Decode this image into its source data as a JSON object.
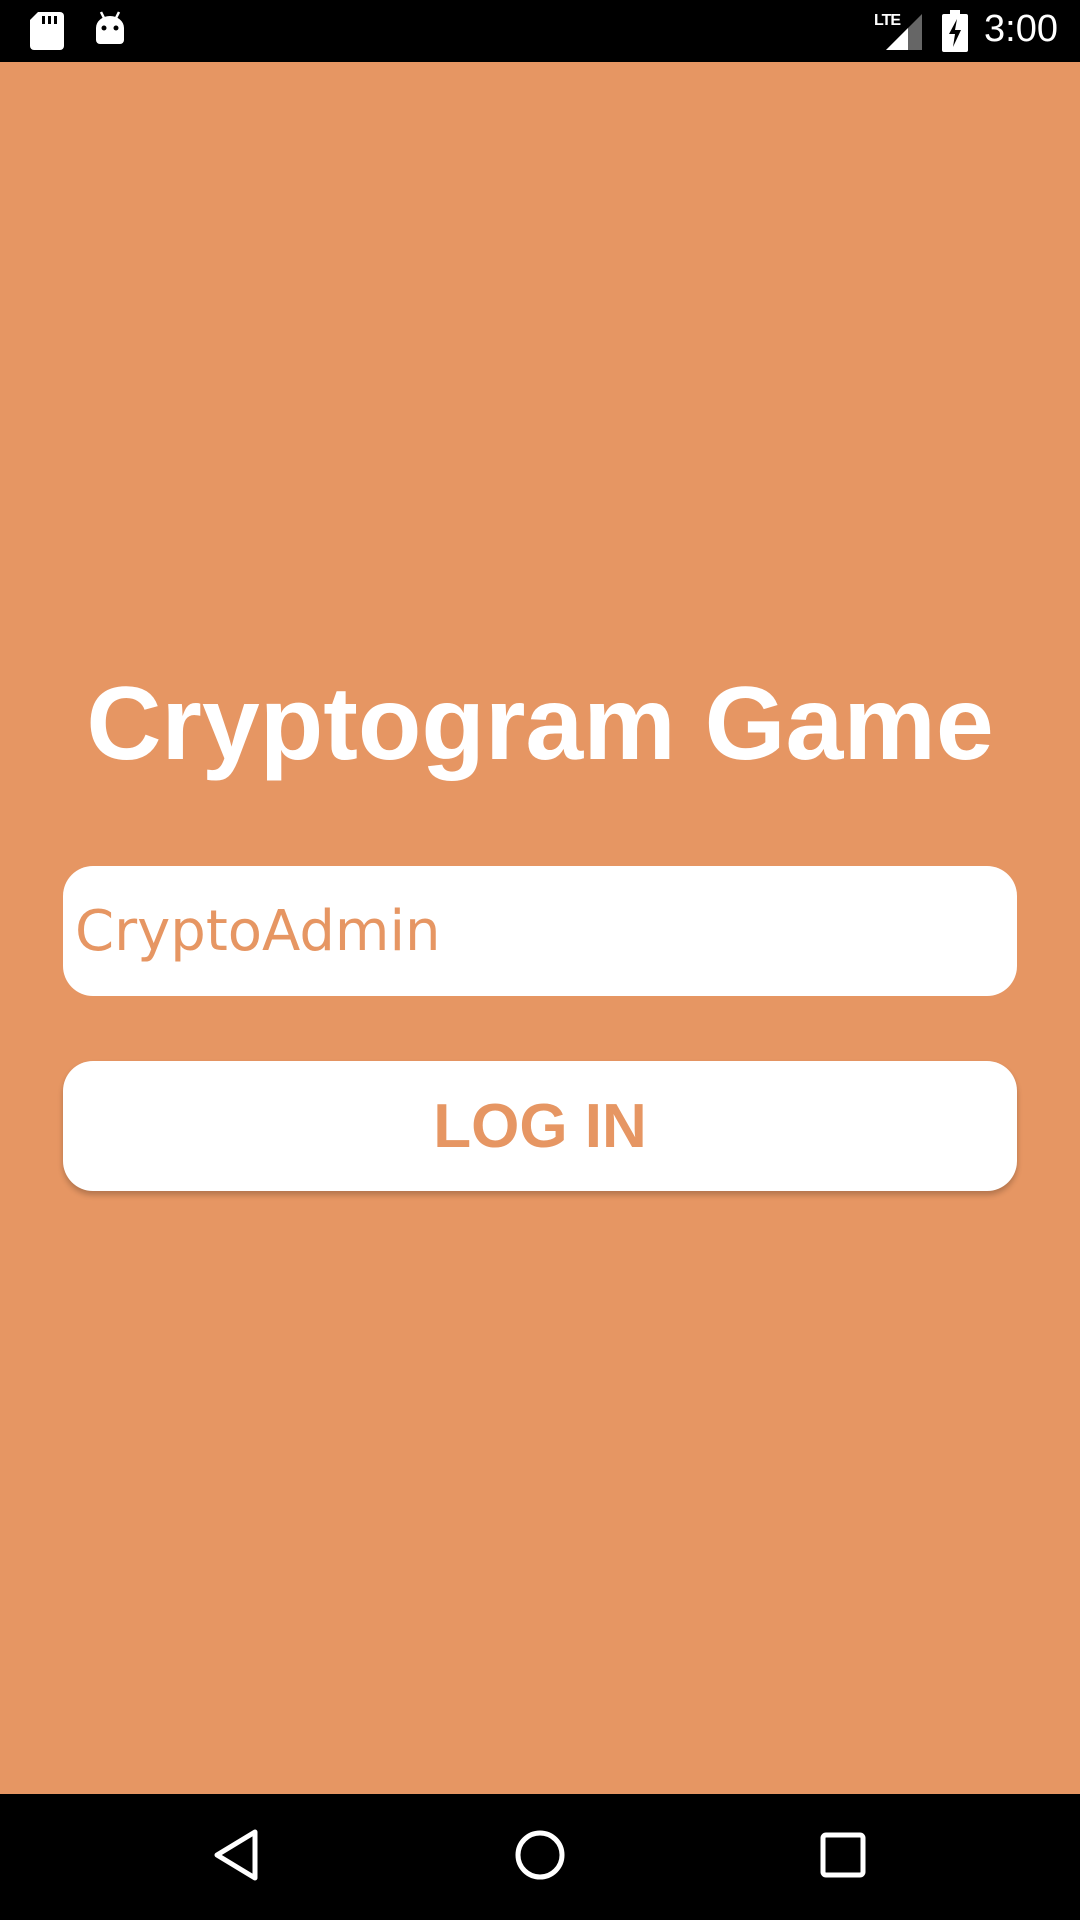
{
  "status_bar": {
    "network_label": "LTE",
    "time": "3:00",
    "icons": [
      "sd-card-icon",
      "android-debug-icon",
      "signal-icon",
      "battery-charging-icon"
    ]
  },
  "app": {
    "title": "Cryptogram Game",
    "username_field": {
      "placeholder": "CryptoAdmin",
      "value": ""
    },
    "login_button_label": "LOG IN"
  },
  "nav_bar": {
    "icons": [
      "back-icon",
      "home-icon",
      "recents-icon"
    ]
  },
  "colors": {
    "background": "#e69663",
    "accent": "#e69663",
    "text_on_bg": "#ffffff",
    "field_bg": "#ffffff",
    "system_bar": "#000000"
  }
}
